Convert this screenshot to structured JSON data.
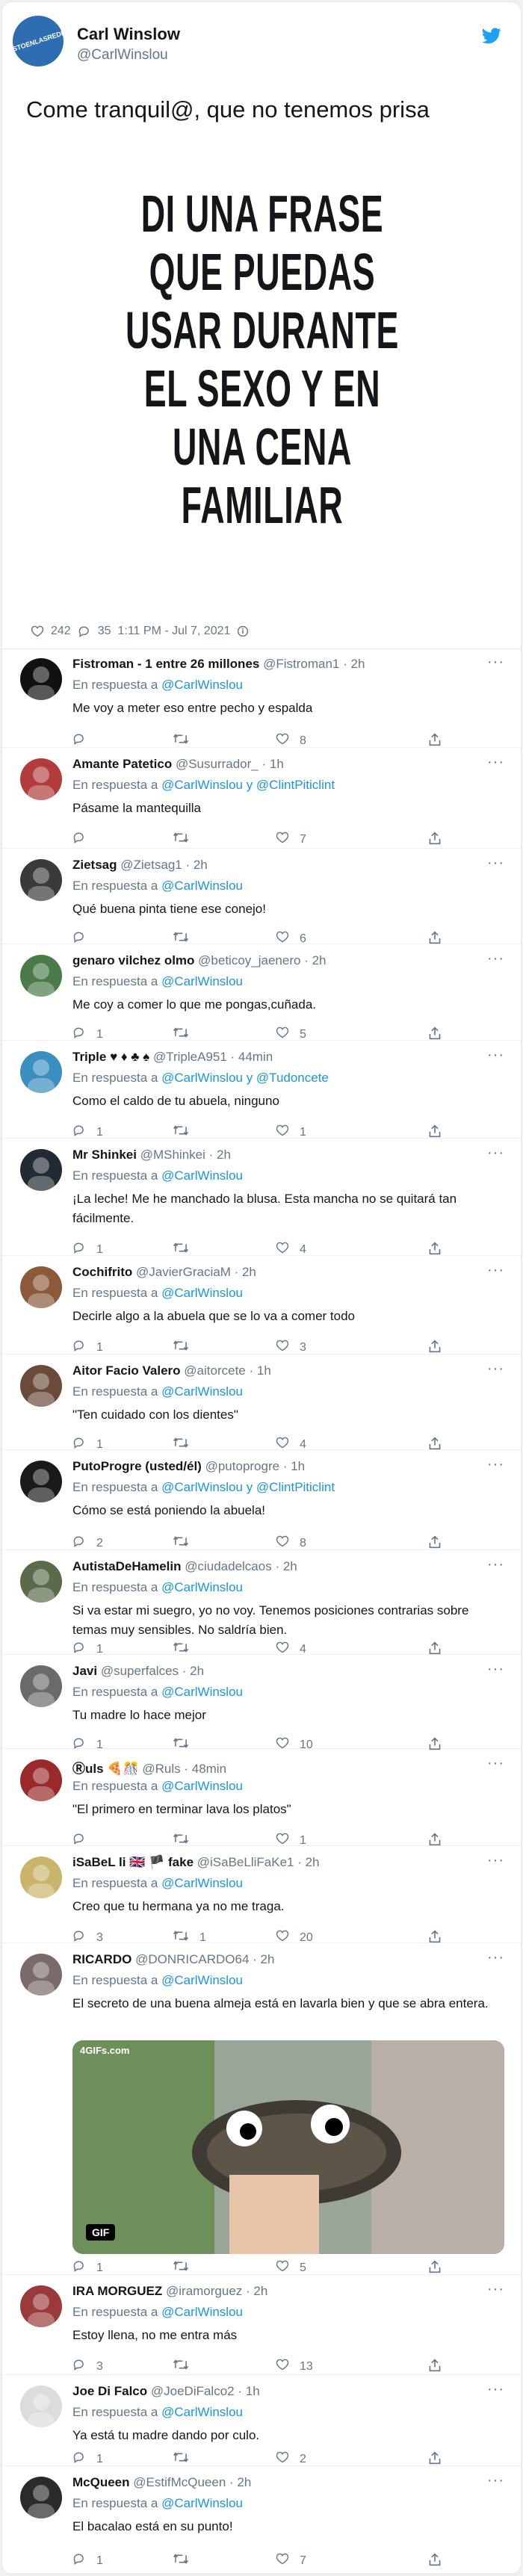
{
  "author": {
    "badge": "VISTOENLASREDES",
    "name": "Carl Winslow",
    "handle": "@CarlWinslou"
  },
  "tweet": {
    "text": "Come tranquil@, que no tenemos prisa",
    "image_lines": [
      "DI UNA FRASE",
      "QUE PUEDAS",
      "USAR DURANTE",
      "EL SEXO Y EN",
      "UNA CENA",
      "FAMILIAR"
    ],
    "likes": "242",
    "replies": "35",
    "time": "1:11 PM - Jul 7, 2021"
  },
  "in_reply_prefix": "En respuesta a",
  "replies": [
    {
      "name": "Fistroman - 1 entre 26 millones",
      "handle": "@Fistroman1",
      "time": "2h",
      "to": "@CarlWinslou",
      "text": "Me voy a meter eso entre pecho y espalda",
      "reply": "",
      "rt": "",
      "like": "8",
      "avatar": "#111111"
    },
    {
      "name": "Amante Patetico",
      "handle": "@Susurrador_",
      "time": "1h",
      "to": "@CarlWinslou y @ClintPiticlint",
      "text": "Pásame la mantequilla",
      "reply": "",
      "rt": "",
      "like": "7",
      "avatar": "#b23c3c"
    },
    {
      "name": "Zietsag",
      "handle": "@Zietsag1",
      "time": "2h",
      "to": "@CarlWinslou",
      "text": "Qué buena pinta tiene ese conejo!",
      "reply": "",
      "rt": "",
      "like": "6",
      "avatar": "#3a3a3a"
    },
    {
      "name": "genaro vilchez olmo",
      "handle": "@beticoy_jaenero",
      "time": "2h",
      "to": "@CarlWinslou",
      "text": "Me coy a comer lo que me pongas,cuñada.",
      "reply": "1",
      "rt": "",
      "like": "5",
      "avatar": "#4a7a4a"
    },
    {
      "name": "Triple ♥ ♦ ♣ ♠",
      "handle": "@TripleA951",
      "time": "44min",
      "to": "@CarlWinslou y @Tudoncete",
      "text": "Como el caldo de tu abuela, ninguno",
      "reply": "1",
      "rt": "",
      "like": "1",
      "avatar": "#3a8fbf"
    },
    {
      "name": "Mr Shinkei",
      "handle": "@MShinkei",
      "time": "2h",
      "to": "@CarlWinslou",
      "text": "¡La leche! Me he manchado la blusa. Esta mancha no se quitará tan fácilmente.",
      "reply": "1",
      "rt": "",
      "like": "4",
      "avatar": "#222a33"
    },
    {
      "name": "Cochifrito",
      "handle": "@JavierGraciaM",
      "time": "2h",
      "to": "@CarlWinslou",
      "text": "Decirle algo a la abuela que se lo va a comer todo",
      "reply": "1",
      "rt": "",
      "like": "3",
      "avatar": "#8a5a3a"
    },
    {
      "name": "Aitor Facio Valero",
      "handle": "@aitorcete",
      "time": "1h",
      "to": "@CarlWinslou",
      "text": "\"Ten cuidado con los dientes\"",
      "reply": "1",
      "rt": "",
      "like": "4",
      "avatar": "#6a4a3a"
    },
    {
      "name": "PutoProgre (usted/él)",
      "handle": "@putoprogre",
      "time": "1h",
      "to": "@CarlWinslou y @ClintPiticlint",
      "text": "Cómo se está poniendo la abuela!",
      "reply": "2",
      "rt": "",
      "like": "8",
      "avatar": "#1a1a1a"
    },
    {
      "name": "AutistaDeHamelin",
      "handle": "@ciudadelcaos",
      "time": "2h",
      "to": "@CarlWinslou",
      "text": "Si va estar mi suegro, yo no voy. Tenemos posiciones contrarias sobre temas muy sensibles. No saldría bien.",
      "reply": "1",
      "rt": "",
      "like": "4",
      "avatar": "#5a6a4a"
    },
    {
      "name": "Javi",
      "handle": "@superfalces",
      "time": "2h",
      "to": "@CarlWinslou",
      "text": "Tu madre lo hace mejor",
      "reply": "1",
      "rt": "",
      "like": "10",
      "avatar": "#6a6a6a"
    },
    {
      "name": "Ⓡuls 🍕🎊",
      "handle": "@Ruls",
      "time": "48min",
      "to": "@CarlWinslou",
      "text": "\"El primero en terminar lava los platos\"",
      "reply": "",
      "rt": "",
      "like": "1",
      "avatar": "#9a2a2a"
    },
    {
      "name": "iSaBeL li 🇬🇧 🏴 fake",
      "handle": "@iSaBeLliFaKe1",
      "time": "2h",
      "to": "@CarlWinslou",
      "text": "Creo que tu hermana ya no me traga.",
      "reply": "3",
      "rt": "1",
      "like": "20",
      "avatar": "#c9b46a"
    },
    {
      "name": "RICARDO",
      "handle": "@DONRICARDO64",
      "time": "2h",
      "to": "@CarlWinslou",
      "text": "El secreto  de una buena almeja está en lavarla bien y que se  abra entera.",
      "reply": "1",
      "rt": "",
      "like": "5",
      "avatar": "#7a6a6a",
      "gif": "GIF",
      "gif_brand": "4GIFs.com"
    },
    {
      "name": "IRA MORGUEZ",
      "handle": "@iramorguez",
      "time": "2h",
      "to": "@CarlWinslou",
      "text": "Estoy llena, no me entra más",
      "reply": "3",
      "rt": "",
      "like": "13",
      "avatar": "#9a3a3a"
    },
    {
      "name": "Joe Di Falco",
      "handle": "@JoeDiFalco2",
      "time": "1h",
      "to": "@CarlWinslou",
      "text": "Ya está tu madre dando por culo.",
      "reply": "1",
      "rt": "",
      "like": "2",
      "avatar": "#dcdcdc"
    },
    {
      "name": "McQueen",
      "handle": "@EstifMcQueen",
      "time": "2h",
      "to": "@CarlWinslou",
      "text": "El bacalao está en su punto!",
      "reply": "1",
      "rt": "",
      "like": "7",
      "avatar": "#2a2a2a"
    }
  ],
  "colors": {
    "accent": "#1da1f2",
    "link": "#1b95e0",
    "muted": "#657786"
  }
}
